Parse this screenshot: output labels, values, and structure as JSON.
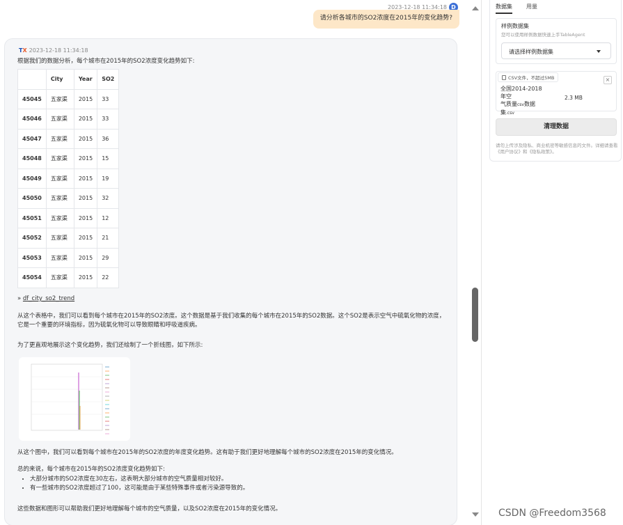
{
  "user": {
    "timestamp": "2023-12-18 11:34:18",
    "avatar_letter": "D",
    "message": "请分析各城市的SO2浓度在2015年的变化趋势?"
  },
  "bot": {
    "logo": "TX",
    "timestamp": "2023-12-18 11:34:18",
    "intro": "根据我们的数据分析，每个城市在2015年的SO2浓度变化趋势如下:",
    "table": {
      "headers": [
        "",
        "City",
        "Year",
        "SO2"
      ],
      "rows": [
        [
          "45045",
          "五家渠",
          "2015",
          "33"
        ],
        [
          "45046",
          "五家渠",
          "2015",
          "33"
        ],
        [
          "45047",
          "五家渠",
          "2015",
          "36"
        ],
        [
          "45048",
          "五家渠",
          "2015",
          "15"
        ],
        [
          "45049",
          "五家渠",
          "2015",
          "19"
        ],
        [
          "45050",
          "五家渠",
          "2015",
          "32"
        ],
        [
          "45051",
          "五家渠",
          "2015",
          "12"
        ],
        [
          "45052",
          "五家渠",
          "2015",
          "21"
        ],
        [
          "45053",
          "五家渠",
          "2015",
          "29"
        ],
        [
          "45054",
          "五家渠",
          "2015",
          "22"
        ]
      ]
    },
    "link_prefix": "»",
    "link_text": "df_city_so2_trend",
    "para1": "从这个表格中，我们可以看到每个城市在2015年的SO2浓度。这个数据是基于我们收集的每个城市在2015年的SO2数据。这个SO2是表示空气中硫氧化物的浓度，它是一个重要的环境指标，因为硫氧化物可以导致眼睛和呼吸道疾病。",
    "para2": "为了更直观地展示这个变化趋势，我们还绘制了一个折线图，如下所示:",
    "para3": "从这个图中，我们可以看到每个城市在2015年的SO2浓度的年度变化趋势。这有助于我们更好地理解每个城市的SO2浓度在2015年的变化情况。",
    "para4": "总的来说，每个城市在2015年的SO2浓度变化趋势如下:",
    "bullets": [
      "大部分城市的SO2浓度在30左右，这表明大部分城市的空气质量相对较好。",
      "有一些城市的SO2浓度超过了100，这可能是由于某些特殊事件或者污染源导致的。"
    ],
    "para5": "这些数据和图形可以帮助我们更好地理解每个城市的空气质量，以及SO2浓度在2015年的变化情况。"
  },
  "panel": {
    "tabs": [
      "数据集",
      "用量"
    ],
    "active_tab": 0,
    "sample_title": "样例数据集",
    "sample_subtitle": "您可以使用样例数据快速上手TableAgent",
    "select_placeholder": "请选择样例数据集",
    "file_tag": "CSV文件，不超过5MB",
    "file_name_line1": "全国2014-2018年空",
    "file_name_line2": "气质量",
    "file_name_small": "csv",
    "file_name_line3": "数据",
    "file_name_line4": "集",
    "file_name_ext": ".csv",
    "file_size": "2.3 MB",
    "close_glyph": "×",
    "clear_button": "清理数据",
    "notice": "请勿上传涉及隐私、商业机密等敏感信息的文件。详细请查看《用户协议》和《隐私政策》。"
  },
  "watermark": "CSDN @Freedom3568",
  "colors": {
    "accent": "#3b6fd6",
    "user_bubble": "#fde7c8",
    "logo_orange": "#e95a2b"
  }
}
